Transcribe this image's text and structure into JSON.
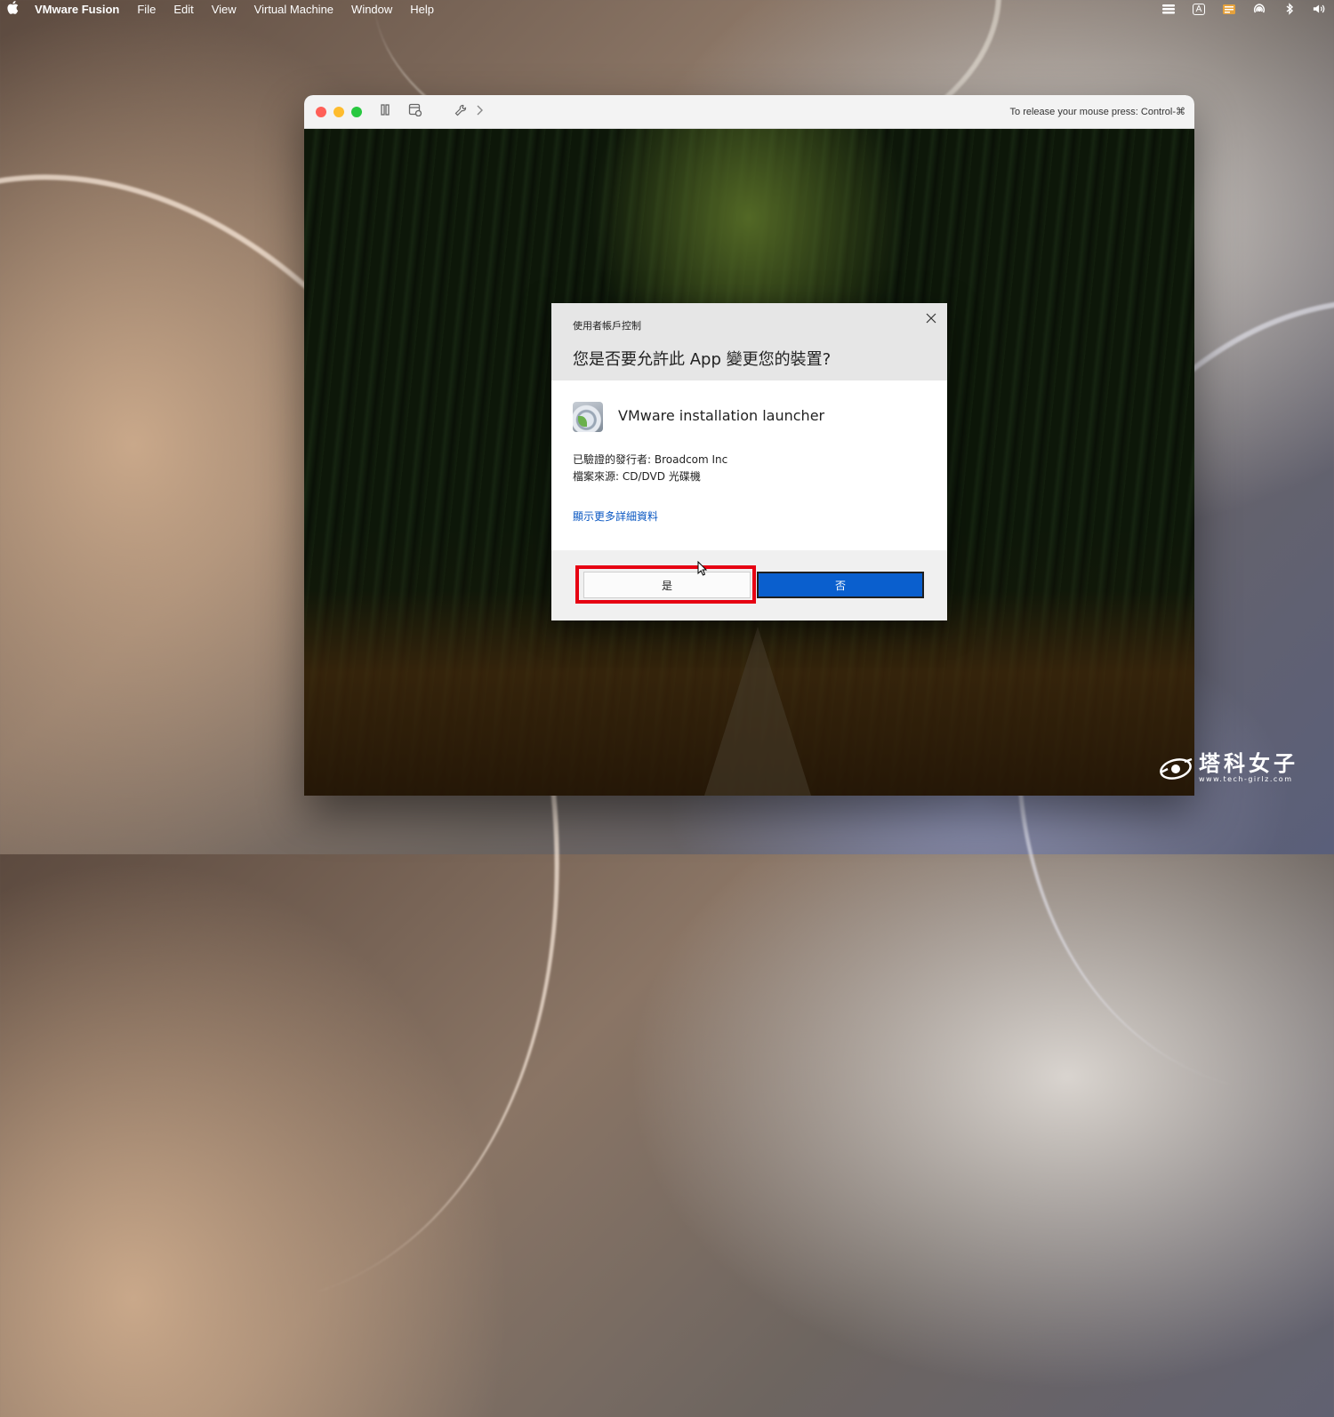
{
  "menubar": {
    "app_name": "VMware Fusion",
    "menus": [
      "File",
      "Edit",
      "View",
      "Virtual Machine",
      "Window",
      "Help"
    ],
    "status_icons": [
      "control-center-icon",
      "input-source-icon",
      "keyboard-viewer-icon",
      "airdrop-icon",
      "bluetooth-icon",
      "volume-icon"
    ],
    "input_source_label": "A"
  },
  "vm_window": {
    "release_hint": "To release your mouse press: Control-⌘"
  },
  "uac": {
    "caption": "使用者帳戶控制",
    "question": "您是否要允許此 App 變更您的裝置?",
    "app_name": "VMware installation launcher",
    "publisher": "已驗證的發行者: Broadcom Inc",
    "origin": "檔案來源: CD/DVD 光碟機",
    "details_link": "顯示更多詳細資料",
    "yes_label": "是",
    "no_label": "否"
  },
  "watermark": {
    "title": "塔科女子",
    "url": "www.tech-girlz.com"
  },
  "colors": {
    "highlight": "#e60012",
    "primary_button": "#0a5fce",
    "link": "#0a57c2"
  }
}
